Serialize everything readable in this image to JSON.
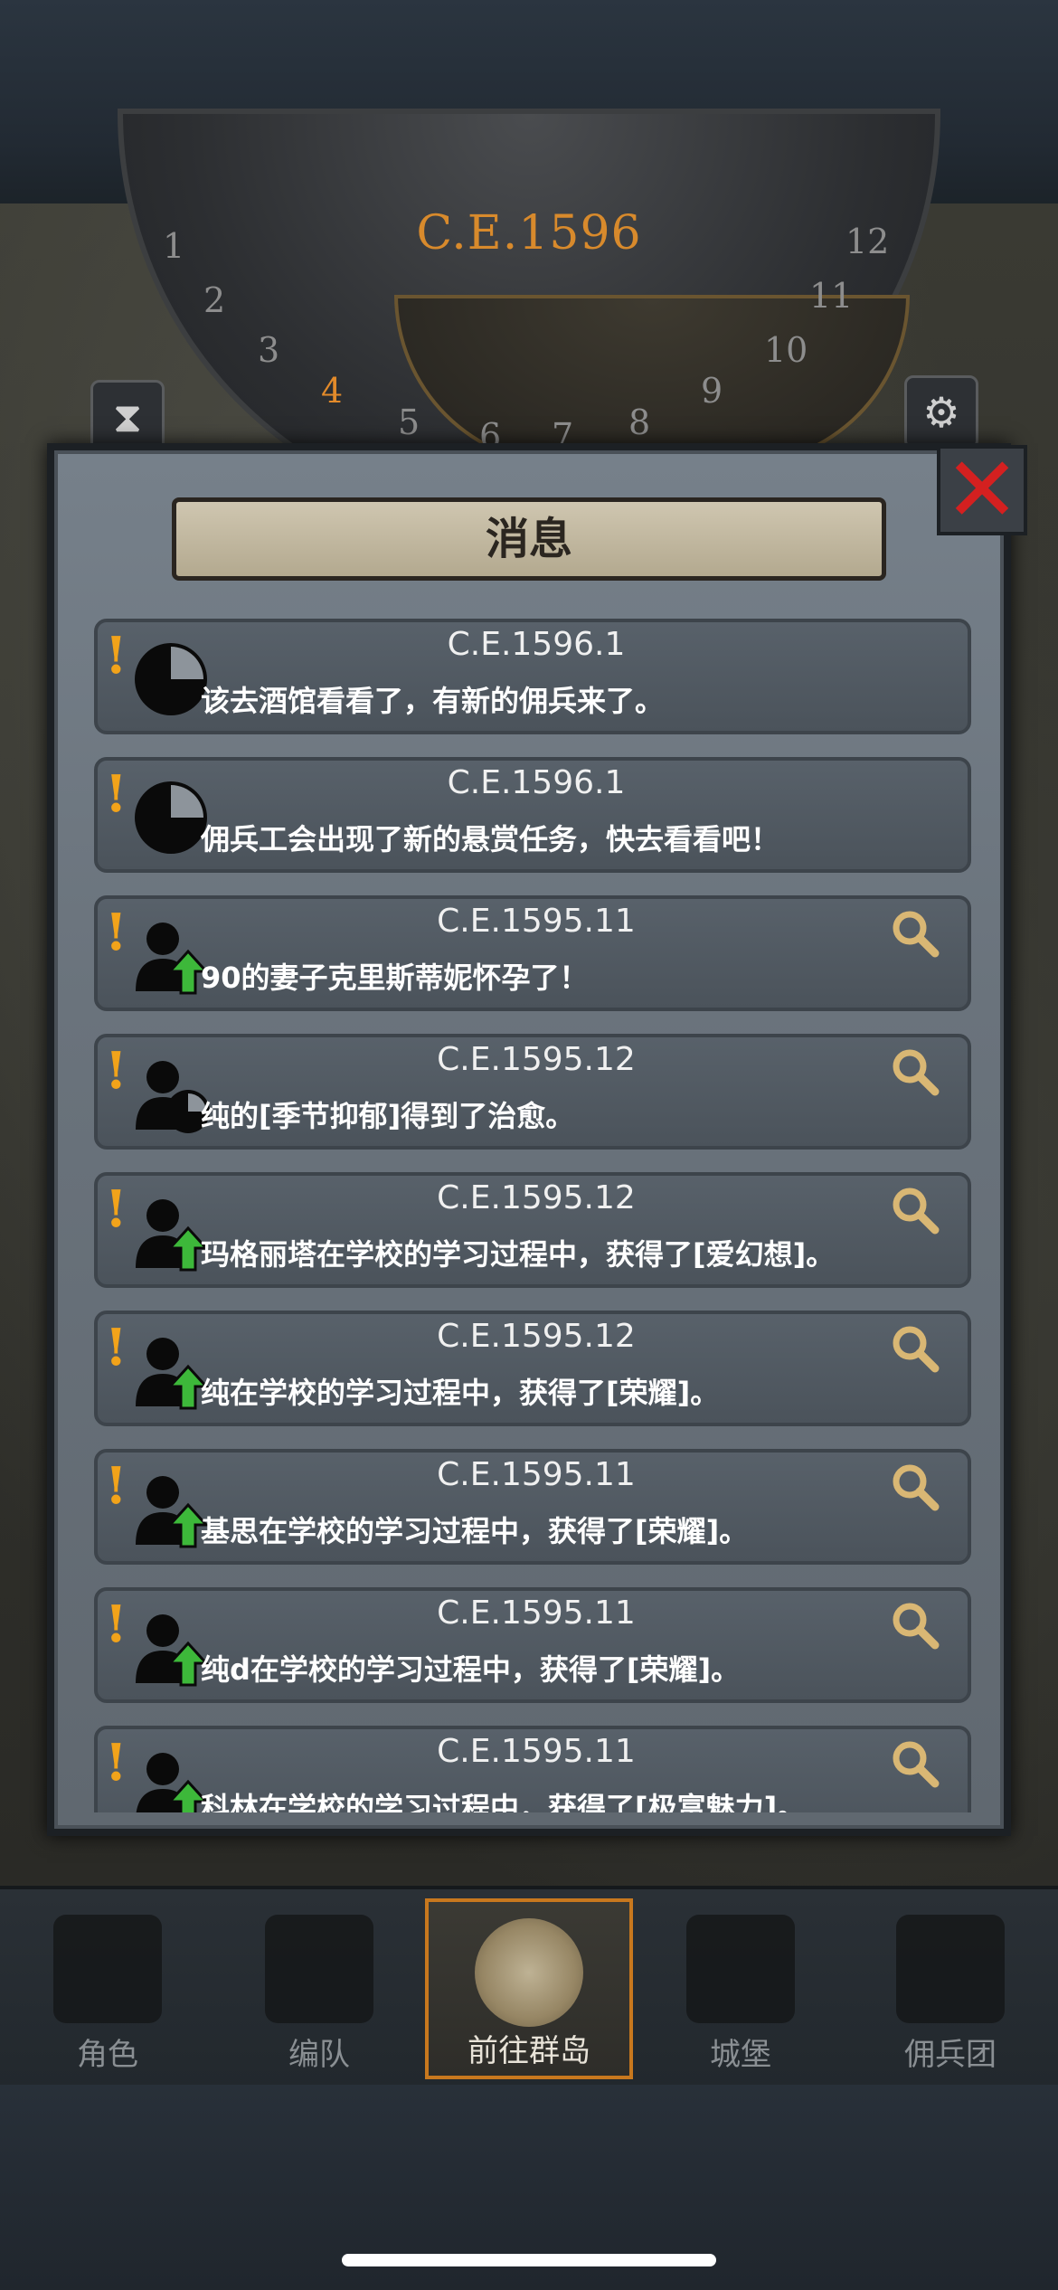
{
  "dial": {
    "year": "C.E.1596",
    "numbers": [
      "1",
      "2",
      "3",
      "4",
      "5",
      "6",
      "7",
      "8",
      "9",
      "10",
      "11",
      "12"
    ],
    "active_month": "4"
  },
  "panel": {
    "title": "消息",
    "close_icon": "close-icon"
  },
  "messages": [
    {
      "date": "C.E.1596.1",
      "text": "该去酒馆看看了，有新的佣兵来了。",
      "icon": "clock-icon",
      "has_search": false
    },
    {
      "date": "C.E.1596.1",
      "text": "佣兵工会出现了新的悬赏任务，快去看看吧！",
      "icon": "clock-icon",
      "has_search": false
    },
    {
      "date": "C.E.1595.11",
      "text": "90的妻子克里斯蒂妮怀孕了！",
      "icon": "person-up-icon",
      "has_search": true
    },
    {
      "date": "C.E.1595.12",
      "text": "纯的[季节抑郁]得到了治愈。",
      "icon": "person-clock-icon",
      "has_search": true
    },
    {
      "date": "C.E.1595.12",
      "text": "玛格丽塔在学校的学习过程中，获得了[爱幻想]。",
      "icon": "person-up-icon",
      "has_search": true
    },
    {
      "date": "C.E.1595.12",
      "text": "纯在学校的学习过程中，获得了[荣耀]。",
      "icon": "person-up-icon",
      "has_search": true
    },
    {
      "date": "C.E.1595.11",
      "text": "基思在学校的学习过程中，获得了[荣耀]。",
      "icon": "person-up-icon",
      "has_search": true
    },
    {
      "date": "C.E.1595.11",
      "text": "纯d在学校的学习过程中，获得了[荣耀]。",
      "icon": "person-up-icon",
      "has_search": true
    },
    {
      "date": "C.E.1595.11",
      "text": "科林在学校的学习过程中，获得了[极富魅力]。",
      "icon": "person-up-icon",
      "has_search": true
    }
  ],
  "nav": {
    "items": [
      {
        "label": "角色",
        "icon": "knight-icon",
        "active": false
      },
      {
        "label": "编队",
        "icon": "helmet-icon",
        "active": false
      },
      {
        "label": "前往群岛",
        "icon": "world-map-icon",
        "active": true
      },
      {
        "label": "城堡",
        "icon": "castle-icon",
        "active": false
      },
      {
        "label": "佣兵团",
        "icon": "banner-icon",
        "active": false
      }
    ]
  },
  "colors": {
    "accent_orange": "#e28a2a",
    "exclaim": "#f2a31a",
    "up_arrow": "#3db83a",
    "close_red": "#d42020"
  }
}
